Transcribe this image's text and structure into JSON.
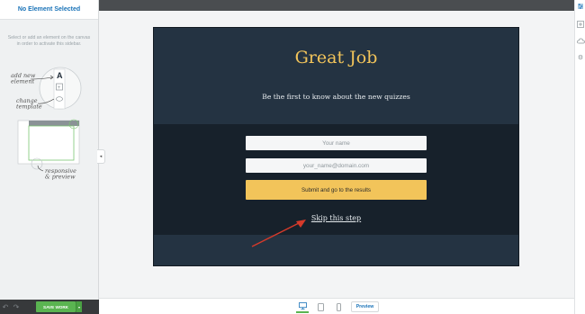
{
  "sidebar": {
    "title": "No Element Selected",
    "hint": "Select or add an element on the canvas in order to activate this sidebar.",
    "illustration": {
      "add_new_element": [
        "add new",
        "element"
      ],
      "change_template": [
        "change",
        "template"
      ],
      "responsive_preview": [
        "responsive",
        "& preview"
      ]
    },
    "footer": {
      "undo_icon": "undo-icon",
      "redo_icon": "redo-icon",
      "save_label": "SAVE WORK"
    }
  },
  "canvas": {
    "title": "Great Job",
    "subtitle": "Be the first to know about the new quizzes",
    "name_placeholder": "Your name",
    "email_placeholder": "your_name@domain.com",
    "submit_label": "Submit and go to the results",
    "skip_label": "Skip this step"
  },
  "bottombar": {
    "devices": [
      "desktop-icon",
      "tablet-icon",
      "mobile-icon"
    ],
    "active_device": "desktop",
    "preview_label": "Preview"
  },
  "right_toolbar": {
    "icons": [
      "sliders-icon",
      "add-element-icon",
      "cloud-template-icon",
      "gear-icon"
    ]
  },
  "colors": {
    "canvas_bg": "#243342",
    "form_band_bg": "#17212b",
    "accent_gold": "#f2c45a",
    "save_green": "#5ab451",
    "link_blue": "#1a73b8",
    "arrow_red": "#d63a2a"
  }
}
